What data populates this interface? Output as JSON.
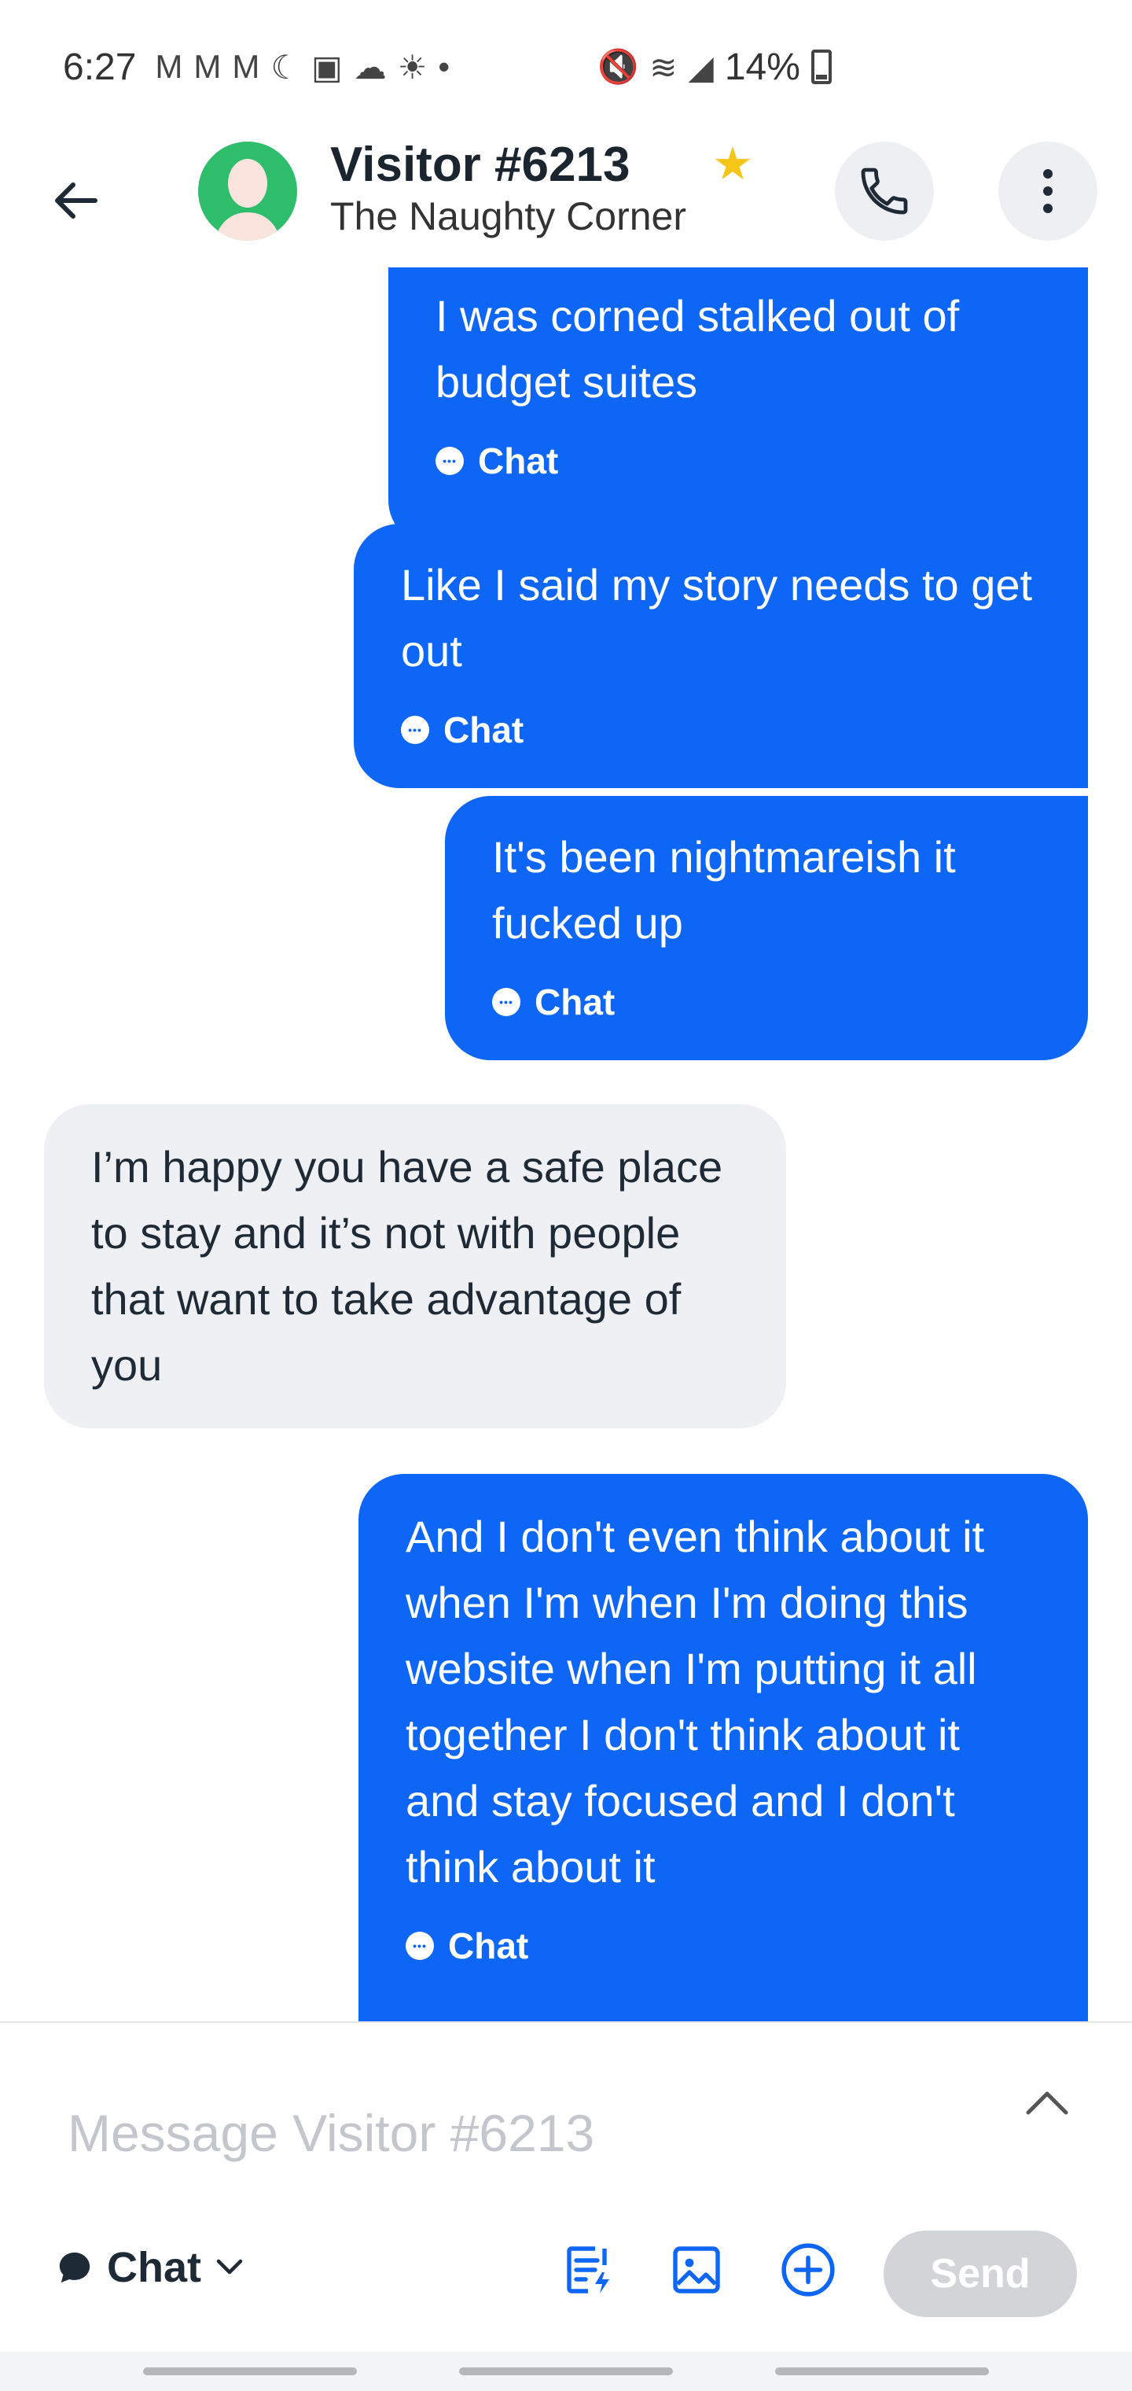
{
  "status_bar": {
    "time": "6:27",
    "battery": "14%"
  },
  "header": {
    "back_icon": "arrow-left-icon",
    "name": "Visitor #6213",
    "subtitle": "The Naughty Corner",
    "star_color": "#f5c518"
  },
  "messages": [
    {
      "direction": "out",
      "text": "I was corned stalked out of budget suites",
      "channel": "Chat"
    },
    {
      "direction": "out",
      "text": "Like I said my story needs to get out",
      "channel": "Chat"
    },
    {
      "direction": "out",
      "text": "It's been nightmareish it fucked up",
      "channel": "Chat"
    },
    {
      "direction": "in",
      "text": "I’m happy you have a safe place to stay and it’s not with people that want to take advantage of you"
    },
    {
      "direction": "out",
      "text": "And I don't even think about it when I'm when I'm doing this website when I'm putting it all together I don't think about it and stay focused and I don't think about it",
      "channel": "Chat"
    }
  ],
  "composer": {
    "value": "",
    "placeholder": "Message Visitor #6213",
    "channel_label": "Chat",
    "send_label": "Send"
  },
  "colors": {
    "outgoing_bubble": "#0d66f5",
    "incoming_bubble": "#eff0f3",
    "avatar_bg": "#2ebd6b",
    "send_disabled": "#d2d4d8"
  }
}
